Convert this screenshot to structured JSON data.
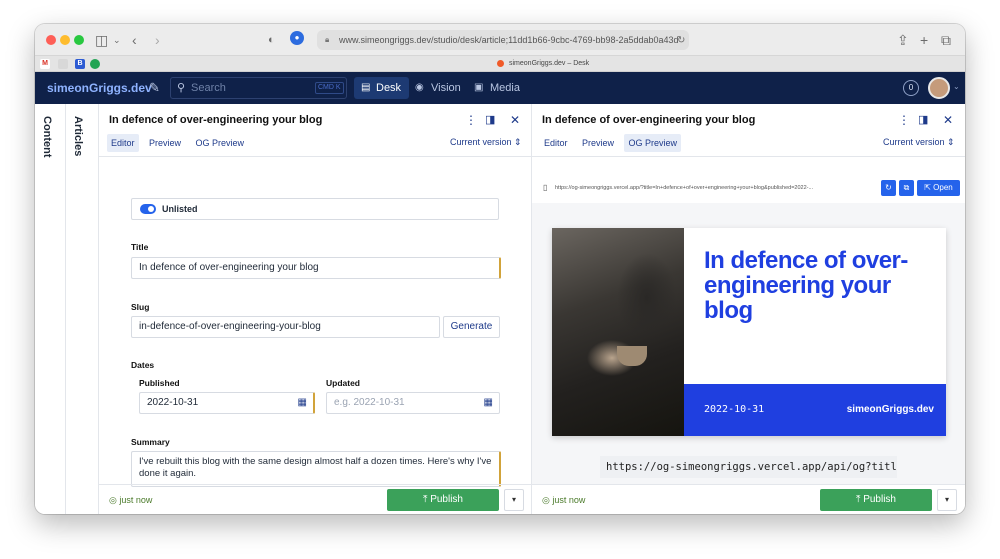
{
  "browser": {
    "url": "www.simeongriggs.dev/studio/desk/article;11dd1b66-9cbc-4769-bb98-2a5ddab0a43d",
    "tab_title": "simeonGriggs.dev – Desk",
    "favicons": [
      "M",
      "",
      "B",
      ""
    ]
  },
  "app": {
    "brand": "simeonGriggs.dev",
    "search_placeholder": "Search",
    "search_shortcut": "CMD K",
    "nav": [
      {
        "label": "Desk",
        "icon": "desk-icon",
        "active": true
      },
      {
        "label": "Vision",
        "icon": "eye-icon",
        "active": false
      },
      {
        "label": "Media",
        "icon": "image-icon",
        "active": false
      }
    ],
    "notifications": "0"
  },
  "sidebar": {
    "content_label": "Content",
    "articles_label": "Articles"
  },
  "editor": {
    "title": "In defence of over-engineering your blog",
    "tabs": [
      "Editor",
      "Preview",
      "OG Preview"
    ],
    "version": "Current version",
    "unlisted_label": "Unlisted",
    "fields": {
      "title_label": "Title",
      "title_value": "In defence of over-engineering your blog",
      "slug_label": "Slug",
      "slug_value": "in-defence-of-over-engineering-your-blog",
      "generate_label": "Generate",
      "dates_label": "Dates",
      "published_label": "Published",
      "published_value": "2022-10-31",
      "updated_label": "Updated",
      "updated_placeholder": "e.g. 2022-10-31",
      "summary_label": "Summary",
      "summary_value": "I've rebuilt this blog with the same design almost half a dozen times. Here's why I've done it again."
    },
    "status": "just now",
    "publish_label": "Publish"
  },
  "og_panel": {
    "title": "In defence of over-engineering your blog",
    "tabs": [
      "Editor",
      "Preview",
      "OG Preview"
    ],
    "version": "Current version",
    "preview_url": "https://og-simeongriggs.vercel.app/?title=In+defence+of+over+engineering+your+blog&published=2022-...",
    "open_label": "Open",
    "card_title": "In defence of over-engineering your blog",
    "card_date": "2022-10-31",
    "card_site": "simeonGriggs.dev",
    "api_url": "https://og-simeongriggs.vercel.app/api/og?title=",
    "status": "just now",
    "publish_label": "Publish"
  },
  "colors": {
    "brand_navy": "#0f2149",
    "accent_blue": "#1f3fe0",
    "publish_green": "#3ba15a"
  }
}
